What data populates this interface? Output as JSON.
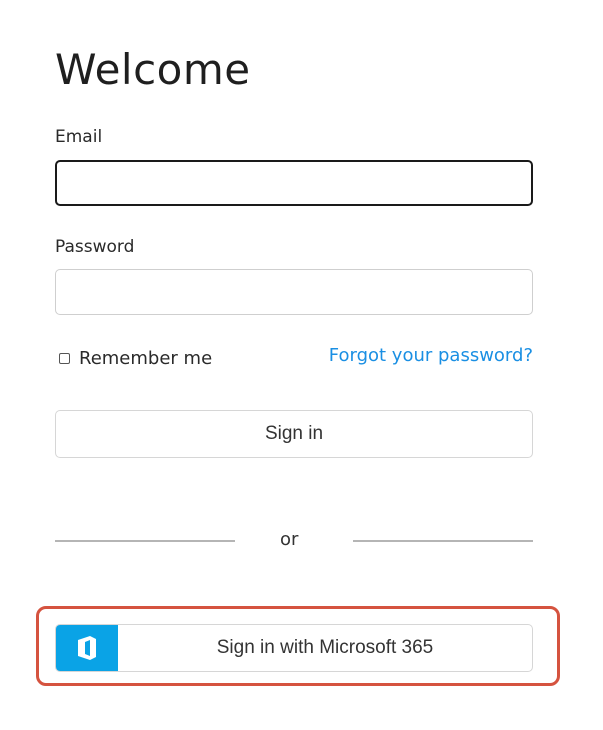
{
  "title": "Welcome",
  "email": {
    "label": "Email",
    "value": "",
    "placeholder": ""
  },
  "password": {
    "label": "Password",
    "value": "",
    "placeholder": ""
  },
  "remember": {
    "label": "Remember me",
    "checked": false
  },
  "forgot_link": "Forgot your password?",
  "signin_button": "Sign in",
  "divider_text": "or",
  "ms_button": {
    "label": "Sign in with Microsoft 365",
    "icon": "microsoft-office-icon"
  },
  "colors": {
    "link": "#1a8fe3",
    "highlight": "#d5533f",
    "ms_icon_bg": "#0aa3e6"
  }
}
